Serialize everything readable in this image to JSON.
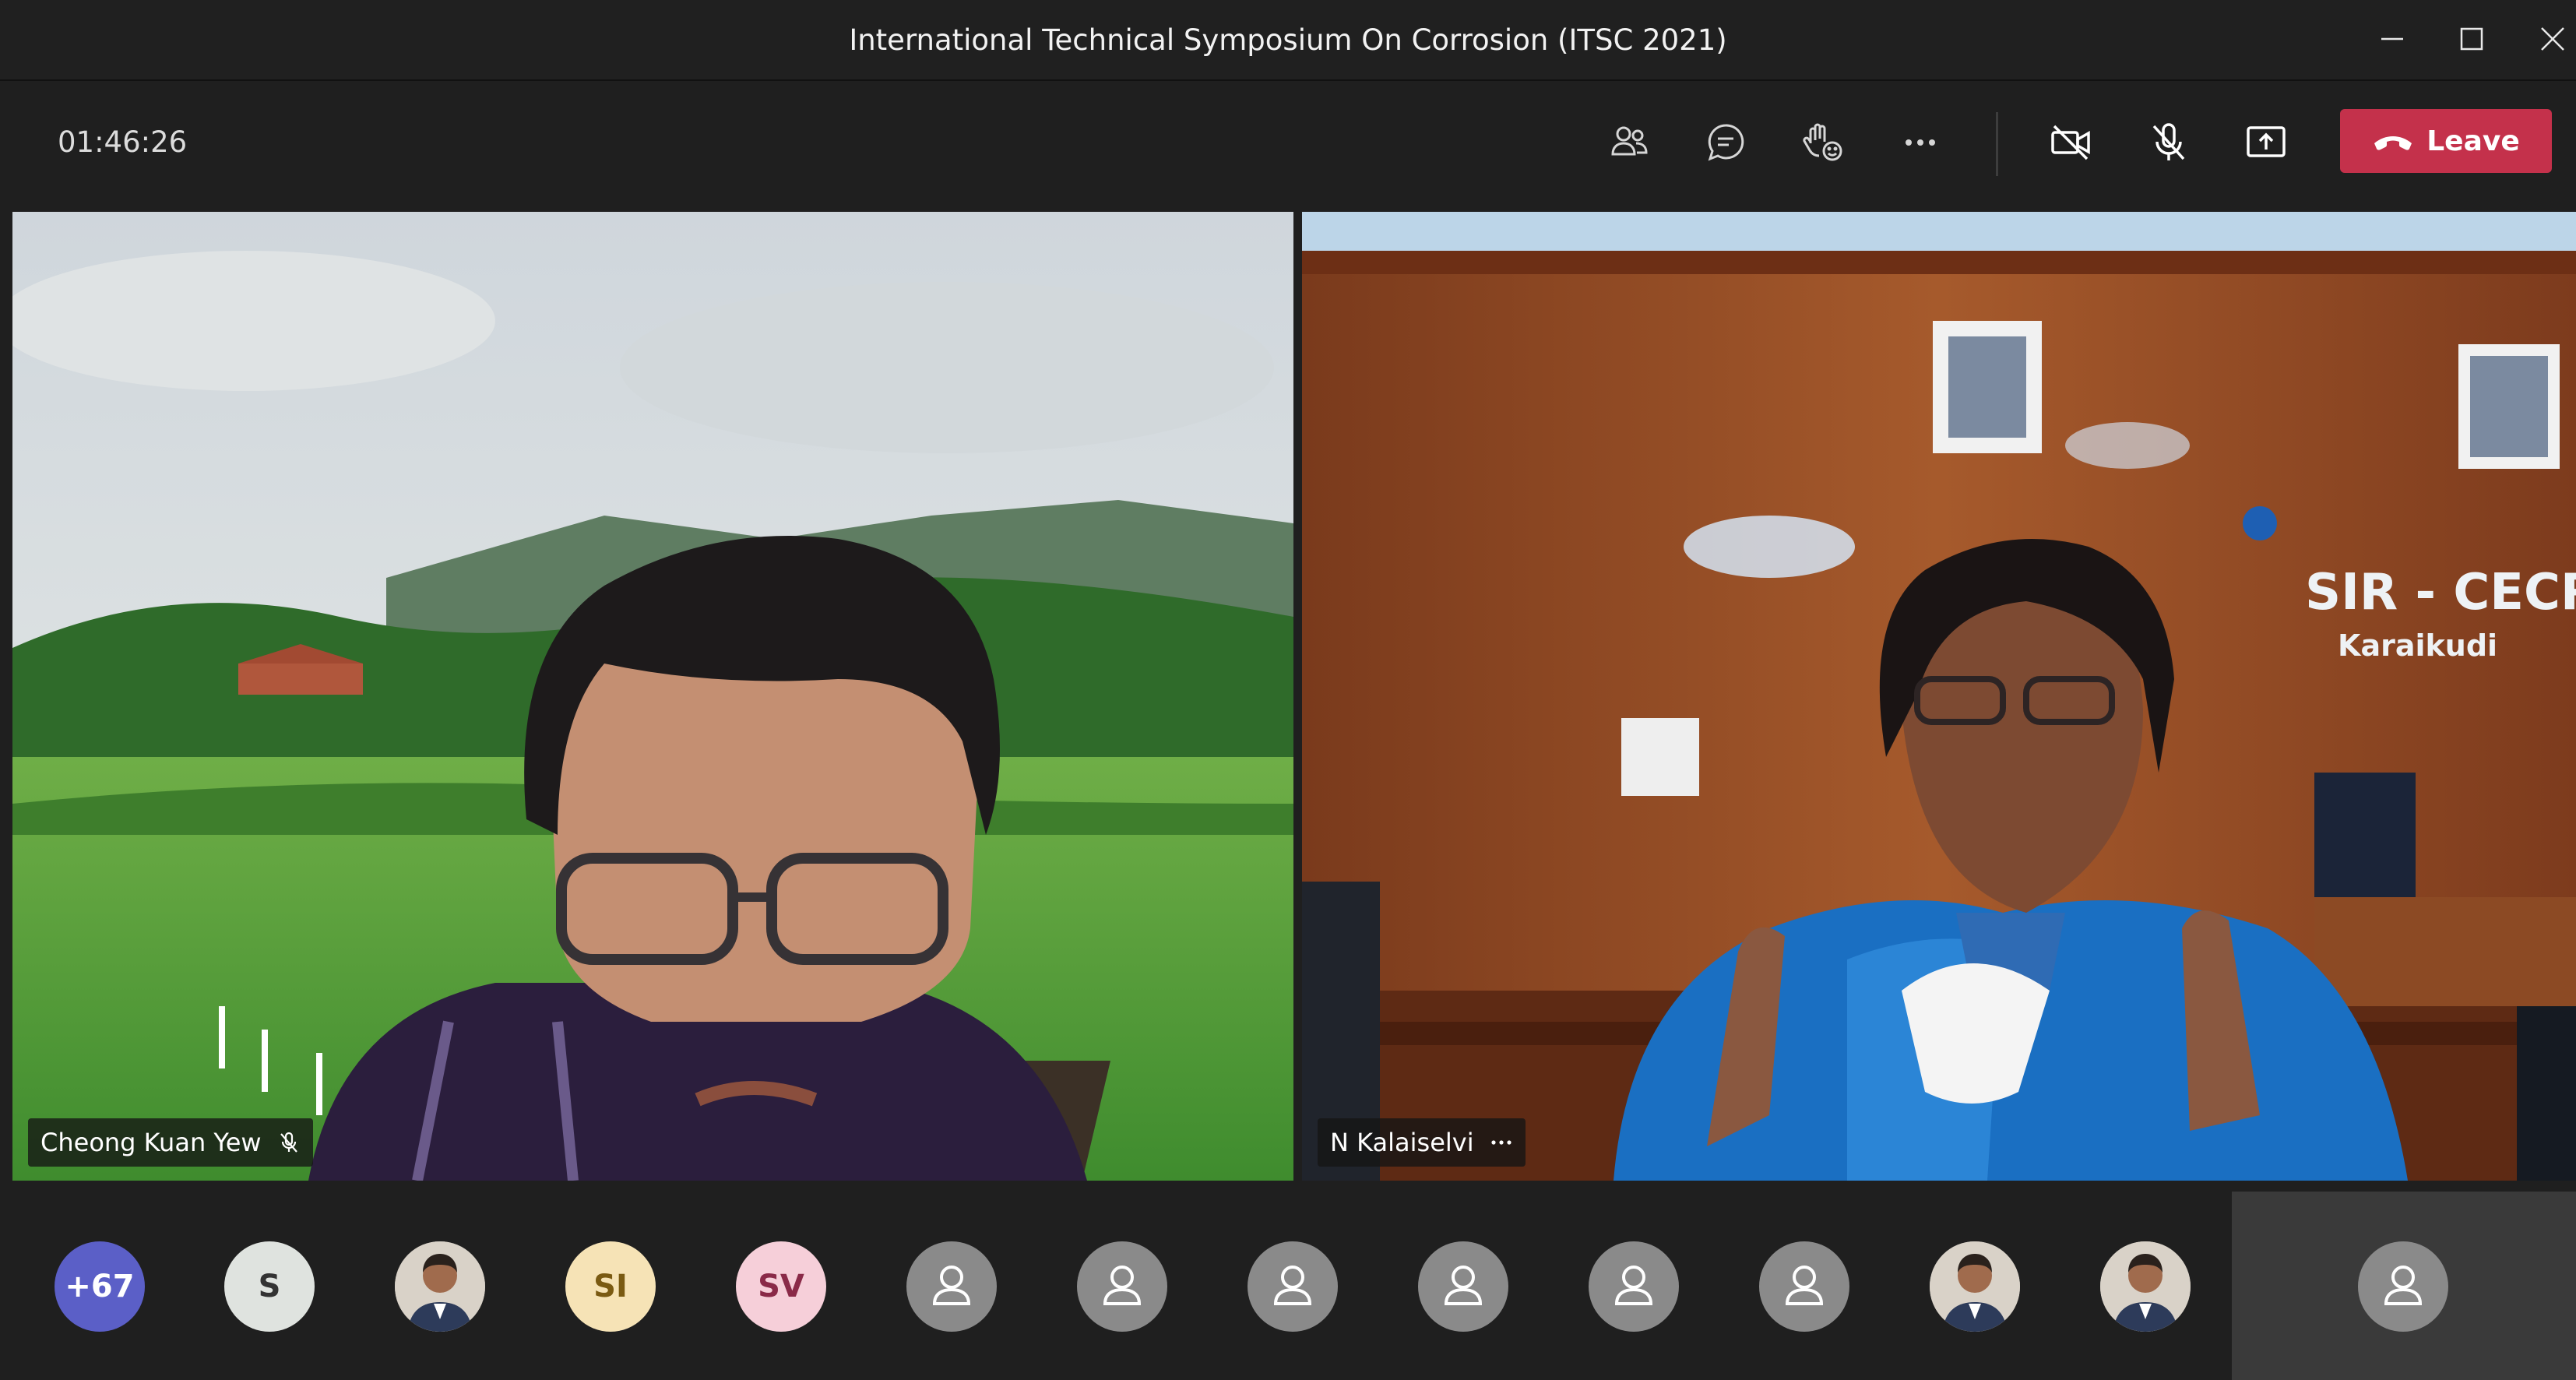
{
  "window": {
    "title": "International Technical Symposium On Corrosion (ITSC 2021)"
  },
  "toolbar": {
    "timer": "01:46:26",
    "leave_label": "Leave"
  },
  "tiles": [
    {
      "name": "Cheong Kuan Yew",
      "status_icon": "mic-off-icon"
    },
    {
      "name": "N Kalaiselvi",
      "status_icon": "more-options-icon"
    }
  ],
  "participants": {
    "overflow": {
      "label": "+67",
      "color": "#5b5fc7"
    },
    "items": [
      {
        "type": "initials",
        "text": "S",
        "bg": "#dfe3df",
        "fg": "#333333"
      },
      {
        "type": "photo"
      },
      {
        "type": "initials",
        "text": "SI",
        "bg": "#f6e3b6",
        "fg": "#7a5a12"
      },
      {
        "type": "initials",
        "text": "SV",
        "bg": "#f6cfd9",
        "fg": "#8a2a48"
      },
      {
        "type": "generic"
      },
      {
        "type": "generic"
      },
      {
        "type": "generic"
      },
      {
        "type": "generic"
      },
      {
        "type": "generic"
      },
      {
        "type": "generic"
      },
      {
        "type": "photo"
      },
      {
        "type": "photo"
      }
    ]
  },
  "colors": {
    "leave": "#c4314b",
    "background": "#1f1f1f"
  }
}
